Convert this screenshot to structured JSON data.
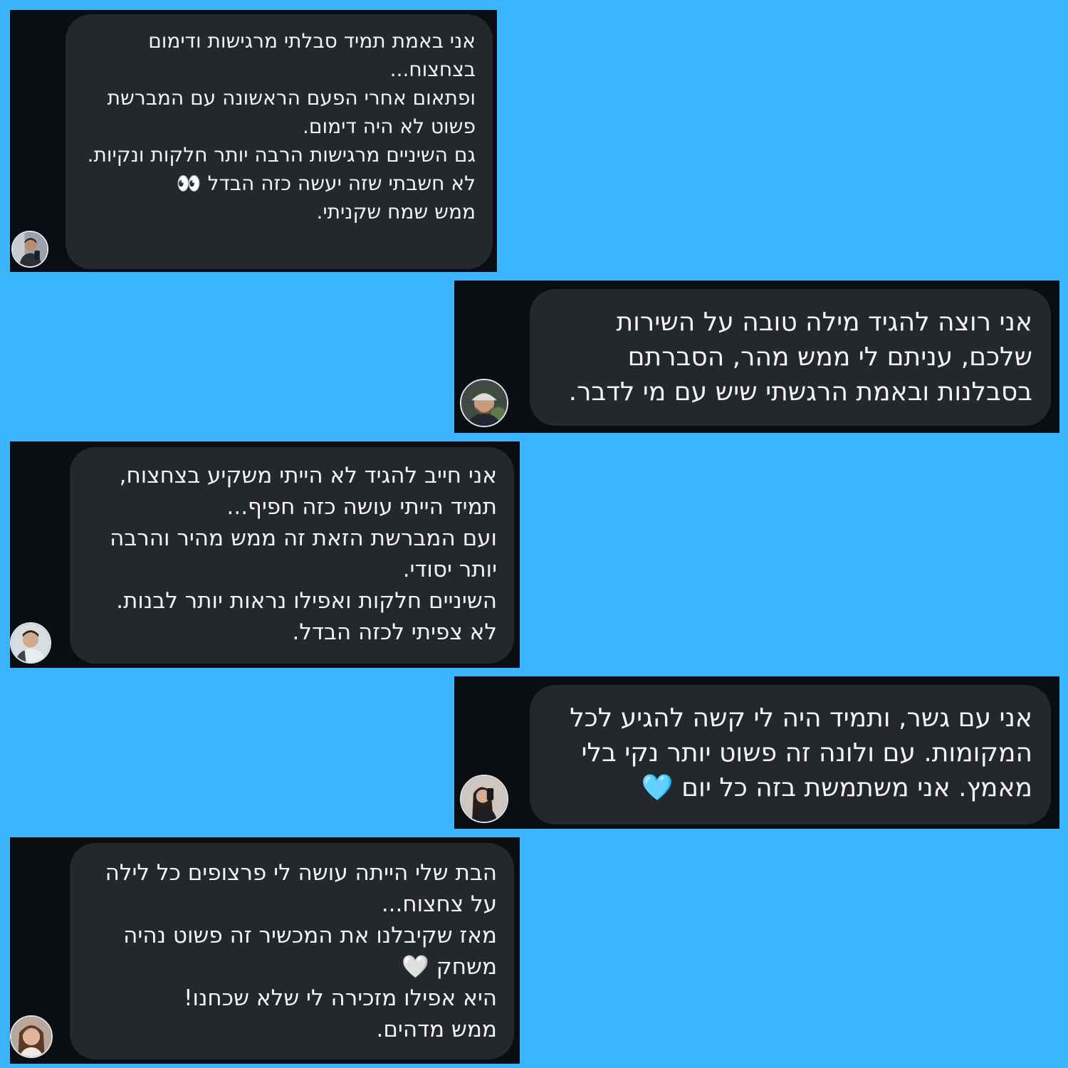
{
  "reviews": [
    {
      "avatar": "user-avatar-man-selfie-icon",
      "text": "אני באמת תמיד סבלתי מרגישות ודימום בצחצוח...\nופתאום אחרי הפעם הראשונה עם המברשת פשוט לא היה דימום.\nגם השיניים מרגישות הרבה יותר חלקות ונקיות.\nלא חשבתי שזה יעשה כזה הבדל 👀\nממש שמח שקניתי."
    },
    {
      "avatar": "user-avatar-man-cap-icon",
      "text": "אני רוצה להגיד מילה טובה על השירות שלכם, עניתם לי ממש מהר, הסברתם בסבלנות ובאמת הרגשתי שיש עם מי לדבר."
    },
    {
      "avatar": "user-avatar-young-man-icon",
      "text": "אני חייב להגיד לא הייתי משקיע בצחצוח, תמיד הייתי עושה כזה חפיף...\nועם המברשת הזאת זה ממש מהיר והרבה יותר יסודי.\nהשיניים חלקות ואפילו נראות יותר לבנות.\nלא צפיתי לכזה הבדל."
    },
    {
      "avatar": "user-avatar-woman-mirror-icon",
      "text": "אני עם גשר, ותמיד היה לי קשה להגיע לכל המקומות. עם ולונה זה פשוט יותר נקי בלי מאמץ. אני משתמשת בזה כל יום 🩵"
    },
    {
      "avatar": "user-avatar-woman-icon",
      "text": "הבת שלי הייתה עושה לי פרצופים כל לילה על צחצוח...\nמאז שקיבלנו את המכשיר זה פשוט נהיה משחק 🤍\nהיא אפילו מזכירה לי שלא שכחנו!\nממש מדהים."
    }
  ]
}
